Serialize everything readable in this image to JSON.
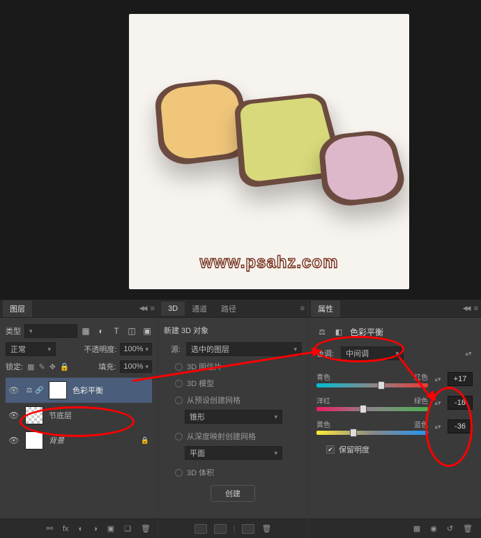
{
  "canvas": {
    "watermark": "www.psahz.com"
  },
  "layers_panel": {
    "tab": "图层",
    "kind_label": "类型",
    "blend_mode": "正常",
    "opacity_label": "不透明度:",
    "opacity_value": "100%",
    "lock_label": "锁定:",
    "fill_label": "填充:",
    "fill_value": "100%",
    "layers": [
      {
        "name": "色彩平衡",
        "selected": true,
        "type": "adj"
      },
      {
        "name": "节底层",
        "selected": false,
        "type": "smart"
      },
      {
        "name": "背景",
        "selected": false,
        "type": "bg"
      }
    ],
    "footer_icons": [
      "fx",
      "fx",
      "◐",
      "◑",
      "▣",
      "❏",
      "🗑"
    ]
  },
  "panel_3d": {
    "tabs": [
      "3D",
      "通道",
      "路径"
    ],
    "section": "新建 3D 对象",
    "source_label": "源:",
    "source_value": "选中的图层",
    "opt1": "3D 明信片",
    "opt2": "3D 模型",
    "opt3": "从预设创建网格",
    "preset": "锥形",
    "opt4": "从深度映射创建网格",
    "depth": "平面",
    "opt5": "3D 体积",
    "create_btn": "创建"
  },
  "props_panel": {
    "tab": "属性",
    "title": "色彩平衡",
    "tone_label": "色调:",
    "tone_value": "中间调",
    "sliders": [
      {
        "left": "青色",
        "right": "红色",
        "value": "+17",
        "pos": 58
      },
      {
        "left": "洋红",
        "right": "绿色",
        "value": "-18",
        "pos": 42
      },
      {
        "left": "黄色",
        "right": "蓝色",
        "value": "-36",
        "pos": 33
      }
    ],
    "preserve": "保留明度"
  }
}
